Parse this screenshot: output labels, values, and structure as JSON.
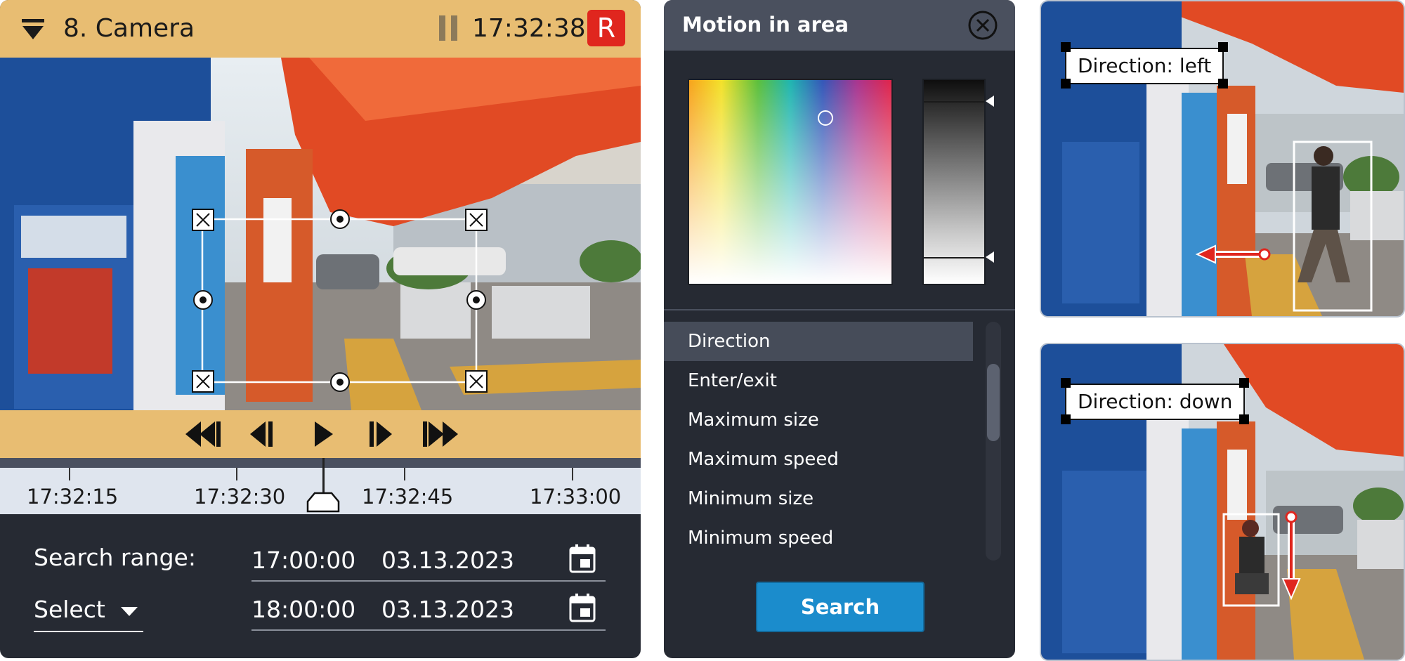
{
  "camera": {
    "title": "8. Camera",
    "time": "17:32:38",
    "record_badge": "R",
    "menu_icon": "dropdown-triangle-icon",
    "pause_icon": "pause-icon",
    "controls": [
      "skip-to-start-icon",
      "step-back-icon",
      "play-icon",
      "step-forward-icon",
      "skip-to-end-icon"
    ],
    "timeline": {
      "ticks": [
        "17:32:15",
        "17:32:30",
        "17:32:45",
        "17:33:00"
      ]
    },
    "search": {
      "label": "Search range:",
      "select_label": "Select",
      "start_time": "17:00:00",
      "start_date": "03.13.2023",
      "end_time": "18:00:00",
      "end_date": "03.13.2023",
      "calendar_icon": "calendar-icon"
    }
  },
  "motion": {
    "title": "Motion in area",
    "close_icon": "close-icon",
    "items": [
      {
        "label": "Direction",
        "selected": true
      },
      {
        "label": "Enter/exit",
        "selected": false
      },
      {
        "label": "Maximum size",
        "selected": false
      },
      {
        "label": "Maximum speed",
        "selected": false
      },
      {
        "label": "Minimum size",
        "selected": false
      },
      {
        "label": "Minimum speed",
        "selected": false
      }
    ],
    "search_button": "Search",
    "colors": {
      "accent": "#1b8ccc",
      "header": "#e8bd72",
      "record": "#e0261e"
    }
  },
  "examples": {
    "top_label": "Direction: left",
    "bottom_label": "Direction: down"
  }
}
